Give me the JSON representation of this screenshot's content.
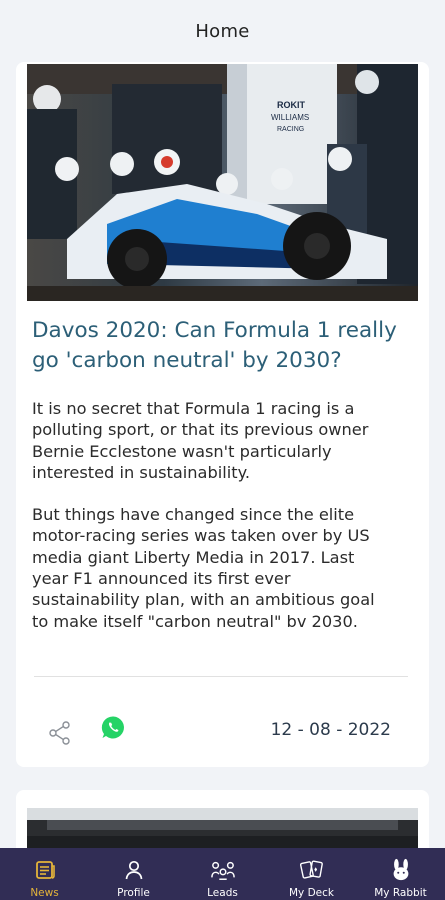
{
  "header": {
    "title": "Home"
  },
  "articles": [
    {
      "image_alt": "F1 car",
      "title": "Davos 2020: Can Formula 1 really go 'carbon neutral' by 2030?",
      "body": [
        "It is no secret that Formula 1 racing is a polluting sport, or that its previous owner Bernie Ecclestone wasn't particularly interested in sustainability.",
        "But things have changed since the elite motor-racing series was taken over by US media giant Liberty Media in 2017. Last year F1 announced its first ever sustainability plan, with an ambitious goal to make itself \"carbon neutral\" bv 2030."
      ],
      "date": "12 - 08 - 2022"
    }
  ],
  "photo_text": {
    "sponsor_line1": "ROKIT",
    "sponsor_line2": "WILLIAMS",
    "sponsor_line3": "RACING"
  },
  "nav": {
    "items": [
      {
        "label": "News",
        "icon": "news-icon",
        "active": true
      },
      {
        "label": "Profile",
        "icon": "profile-icon",
        "active": false
      },
      {
        "label": "Leads",
        "icon": "leads-icon",
        "active": false
      },
      {
        "label": "My Deck",
        "icon": "cards-icon",
        "active": false
      },
      {
        "label": "My Rabbit",
        "icon": "rabbit-icon",
        "active": false
      }
    ]
  },
  "colors": {
    "nav_bg": "#312d55",
    "nav_active": "#e4b43a",
    "title": "#2c5f77",
    "whatsapp": "#25d366"
  }
}
